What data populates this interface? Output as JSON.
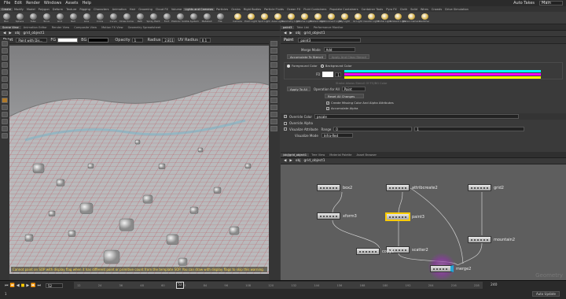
{
  "menu": [
    "File",
    "Edit",
    "Render",
    "Windows",
    "Assets",
    "Help"
  ],
  "auto_takes": "Auto Takes",
  "desktop": "Main",
  "shelf_tabs": [
    "Create",
    "Modify",
    "Model",
    "Polygon",
    "Deform",
    "Texture",
    "Rigging",
    "Characters",
    "Animation",
    "Hair",
    "Grooming",
    "Cloud FX",
    "Volume",
    "Lights and Cameras",
    "Particles",
    "Grains",
    "Rigid Bodies",
    "Particle Fluids",
    "Ocean FX",
    "Fluid Containers",
    "Populate Containers",
    "Container Tools",
    "Pyro FX",
    "Cloth",
    "Solid",
    "Wires",
    "Crowds",
    "Drive Simulation"
  ],
  "tools_left": [
    "Box",
    "Sphere",
    "Tube",
    "Torus",
    "Grid",
    "Null",
    "Line",
    "Circle",
    "Curve",
    "Draw Curve",
    "Path",
    "Spray Paint",
    "Font",
    "Platonic Solids",
    "L-System",
    "Metaball",
    "File"
  ],
  "tools_right": [
    "Camera",
    "Point Light",
    "Spot Light",
    "Area Light",
    "Geometry Light",
    "Volume Light",
    "Distant Light",
    "Environment Light",
    "Sky Light",
    "GI Light",
    "Caustic Light",
    "Portal Light",
    "Ambient Light",
    "Stereo Camera",
    "Switcher"
  ],
  "left_tabs": [
    "Scene View",
    "Animation Editor",
    "Render View",
    "Composite View",
    "Motion FX View",
    "Geometry Spreadsheet"
  ],
  "left_path": [
    "obj",
    "grid_object1"
  ],
  "paint_bar": {
    "label": "Paint",
    "mode": "Paint with Dis...",
    "fg_label": "FG",
    "bg_label": "BG",
    "radius_label": "Radius",
    "radius": "2.811",
    "uv_label": "UV Radius",
    "uv": "0.1",
    "opacity_label": "Opacity",
    "opacity": "1"
  },
  "viewport_message": "Cannot paint on SOP with display flag when it has different point or primitive count from the template SOP. You can draw with display flags to skip this warning.",
  "right_tabs": [
    "paint3",
    "Take List",
    "Performance Monitor"
  ],
  "right_path": [
    "obj",
    "grid_object1"
  ],
  "params": {
    "node_type": "Paint",
    "node_name": "paint3",
    "merge_mode_label": "Merge Mode",
    "merge_mode": "Add",
    "accumulate_stencil": "Accumulate To Stencil",
    "apply_clear": "Apply And Clear Stencil",
    "fg_radio": "Foreground Color",
    "bg_radio": "Background Color",
    "fd_label": "FD",
    "rgb": [
      "1",
      "1",
      "1"
    ],
    "stroke_label": "Stroke Allows Stencil Of FG/BG Color",
    "apply_all": "Apply To All",
    "operation_label": "Operation for All",
    "operation": "Paint",
    "reset_all": "Reset All Changes",
    "create_missing": "Create Missing Color And Alpha Attributes",
    "accumulate_alpha": "Accumulate Alpha",
    "override_color_label": "Override Color",
    "override_color": "pscale",
    "override_alpha": "Override Alpha",
    "visualize_attr_label": "Visualize Attribute",
    "range_label": "Range",
    "range": [
      "0",
      "1"
    ],
    "visualize_mode_label": "Visualize Mode",
    "visualize_mode": "Infra-Red"
  },
  "net_tabs": [
    "/obj/grid_object1",
    "Tree View",
    "Material Palette",
    "Asset Browser"
  ],
  "net_path": [
    "obj",
    "grid_object1"
  ],
  "nodes": [
    {
      "name": "box2"
    },
    {
      "name": "attribcreate2"
    },
    {
      "name": "grid2"
    },
    {
      "name": "xform3"
    },
    {
      "name": "paint3"
    },
    {
      "name": "mountain2"
    },
    {
      "name": "scatter2"
    },
    {
      "name": "copy1"
    },
    {
      "name": "merge2"
    }
  ],
  "net_context": "Geometry",
  "timeline": {
    "frame": "52",
    "start": "1",
    "end": "240",
    "ticks": [
      "12",
      "24",
      "36",
      "48",
      "60",
      "72",
      "84",
      "96",
      "108",
      "120",
      "132",
      "144",
      "156",
      "168",
      "180",
      "192",
      "204",
      "216",
      "228"
    ],
    "auto_update": "Auto Update"
  },
  "colors": {
    "accent": "#ffcc00",
    "selected_node": "#ffcc00"
  }
}
